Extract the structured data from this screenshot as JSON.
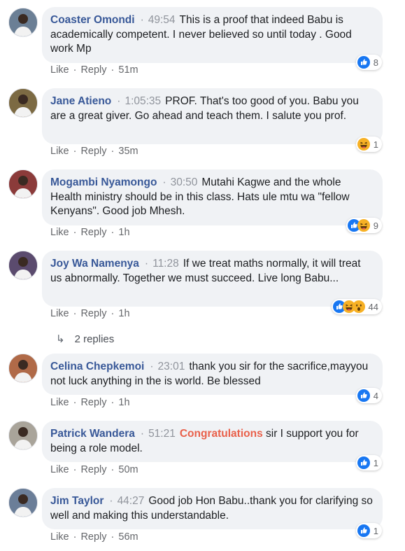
{
  "comments": [
    {
      "author": "Coaster Omondi",
      "timestamp": "49:54",
      "text": "This is a proof that indeed Babu is academically competent. I never believed so until today . Good work Mp",
      "age": "51m",
      "reaction_count": "8",
      "reactions": [
        "like-icon"
      ]
    },
    {
      "author": "Jane Atieno",
      "timestamp": "1:05:35",
      "text": "PROF. That's too good of you. Babu you are a great giver. Go ahead and teach them. I salute you prof.",
      "age": "35m",
      "reaction_count": "1",
      "reactions": [
        "haha-icon"
      ]
    },
    {
      "author": "Mogambi Nyamongo",
      "timestamp": "30:50",
      "text": "Mutahi Kagwe and the whole Health ministry should be in this class. Hats ule mtu wa \"fellow Kenyans\". Good job Mhesh.",
      "age": "1h",
      "reaction_count": "9",
      "reactions": [
        "like-icon",
        "haha-icon"
      ]
    },
    {
      "author": "Joy Wa Namenya",
      "timestamp": "11:28",
      "text": "If we treat maths normally, it will treat us abnormally. Together we must succeed. Live long Babu...",
      "age": "1h",
      "reaction_count": "44",
      "reactions": [
        "like-icon",
        "haha-icon",
        "wow-icon"
      ]
    },
    {
      "author": "Celina Chepkemoi",
      "timestamp": "23:01",
      "text": "thank you sir for the sacrifice,mayyou not luck anything in the is world. Be blessed",
      "age": "1h",
      "reaction_count": "4",
      "reactions": [
        "like-icon"
      ]
    },
    {
      "author": "Patrick Wandera",
      "timestamp": "51:21",
      "highlight": "Congratulations",
      "text": "sir I support you for being a role model.",
      "age": "50m",
      "reaction_count": "1",
      "reactions": [
        "like-icon"
      ]
    },
    {
      "author": "Jim Taylor",
      "timestamp": "44:27",
      "text": "Good job Hon Babu..thank you for clarifying so well and making this understandable.",
      "age": "56m",
      "reaction_count": "1",
      "reactions": [
        "like-icon"
      ]
    }
  ],
  "actions": {
    "like": "Like",
    "reply": "Reply",
    "dot": "·"
  },
  "replies": {
    "arrow": "↳",
    "label": "2 replies"
  },
  "colors": {
    "author": "#385898",
    "bubble": "#f0f2f5",
    "meta": "#90949c",
    "highlight": "#e9604a",
    "like": "#1877f2",
    "haha": "#f7b125"
  }
}
